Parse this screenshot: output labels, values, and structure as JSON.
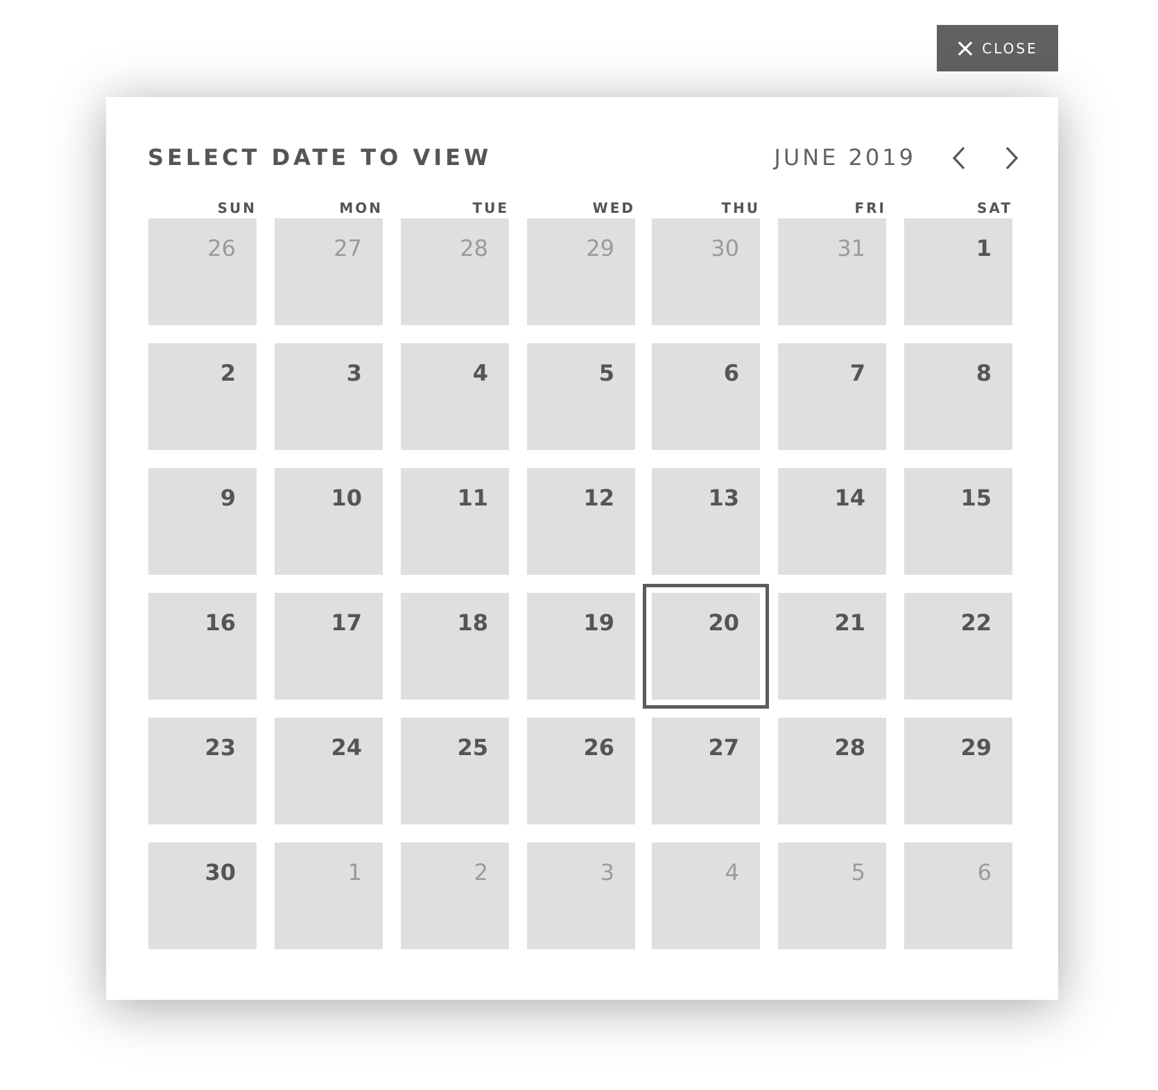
{
  "close_button": {
    "label": "CLOSE",
    "icon": "close-icon"
  },
  "calendar": {
    "title": "SELECT DATE TO VIEW",
    "month_label": "JUNE 2019",
    "prev_icon": "chevron-left-icon",
    "next_icon": "chevron-right-icon",
    "weekdays": [
      "SUN",
      "MON",
      "TUE",
      "WED",
      "THU",
      "FRI",
      "SAT"
    ],
    "selected_day": "20",
    "weeks": [
      [
        {
          "day": "26",
          "in_month": false
        },
        {
          "day": "27",
          "in_month": false
        },
        {
          "day": "28",
          "in_month": false
        },
        {
          "day": "29",
          "in_month": false
        },
        {
          "day": "30",
          "in_month": false
        },
        {
          "day": "31",
          "in_month": false
        },
        {
          "day": "1",
          "in_month": true
        }
      ],
      [
        {
          "day": "2",
          "in_month": true
        },
        {
          "day": "3",
          "in_month": true
        },
        {
          "day": "4",
          "in_month": true
        },
        {
          "day": "5",
          "in_month": true
        },
        {
          "day": "6",
          "in_month": true
        },
        {
          "day": "7",
          "in_month": true
        },
        {
          "day": "8",
          "in_month": true
        }
      ],
      [
        {
          "day": "9",
          "in_month": true
        },
        {
          "day": "10",
          "in_month": true
        },
        {
          "day": "11",
          "in_month": true
        },
        {
          "day": "12",
          "in_month": true
        },
        {
          "day": "13",
          "in_month": true
        },
        {
          "day": "14",
          "in_month": true
        },
        {
          "day": "15",
          "in_month": true
        }
      ],
      [
        {
          "day": "16",
          "in_month": true
        },
        {
          "day": "17",
          "in_month": true
        },
        {
          "day": "18",
          "in_month": true
        },
        {
          "day": "19",
          "in_month": true
        },
        {
          "day": "20",
          "in_month": true
        },
        {
          "day": "21",
          "in_month": true
        },
        {
          "day": "22",
          "in_month": true
        }
      ],
      [
        {
          "day": "23",
          "in_month": true
        },
        {
          "day": "24",
          "in_month": true
        },
        {
          "day": "25",
          "in_month": true
        },
        {
          "day": "26",
          "in_month": true
        },
        {
          "day": "27",
          "in_month": true
        },
        {
          "day": "28",
          "in_month": true
        },
        {
          "day": "29",
          "in_month": true
        }
      ],
      [
        {
          "day": "30",
          "in_month": true
        },
        {
          "day": "1",
          "in_month": false
        },
        {
          "day": "2",
          "in_month": false
        },
        {
          "day": "3",
          "in_month": false
        },
        {
          "day": "4",
          "in_month": false
        },
        {
          "day": "5",
          "in_month": false
        },
        {
          "day": "6",
          "in_month": false
        }
      ]
    ]
  },
  "colors": {
    "button_bg": "#616161",
    "cell_bg": "#dfdfdf",
    "text": "#555555",
    "muted_text": "#9a9a9a",
    "selected_border": "#5b5b5b"
  }
}
